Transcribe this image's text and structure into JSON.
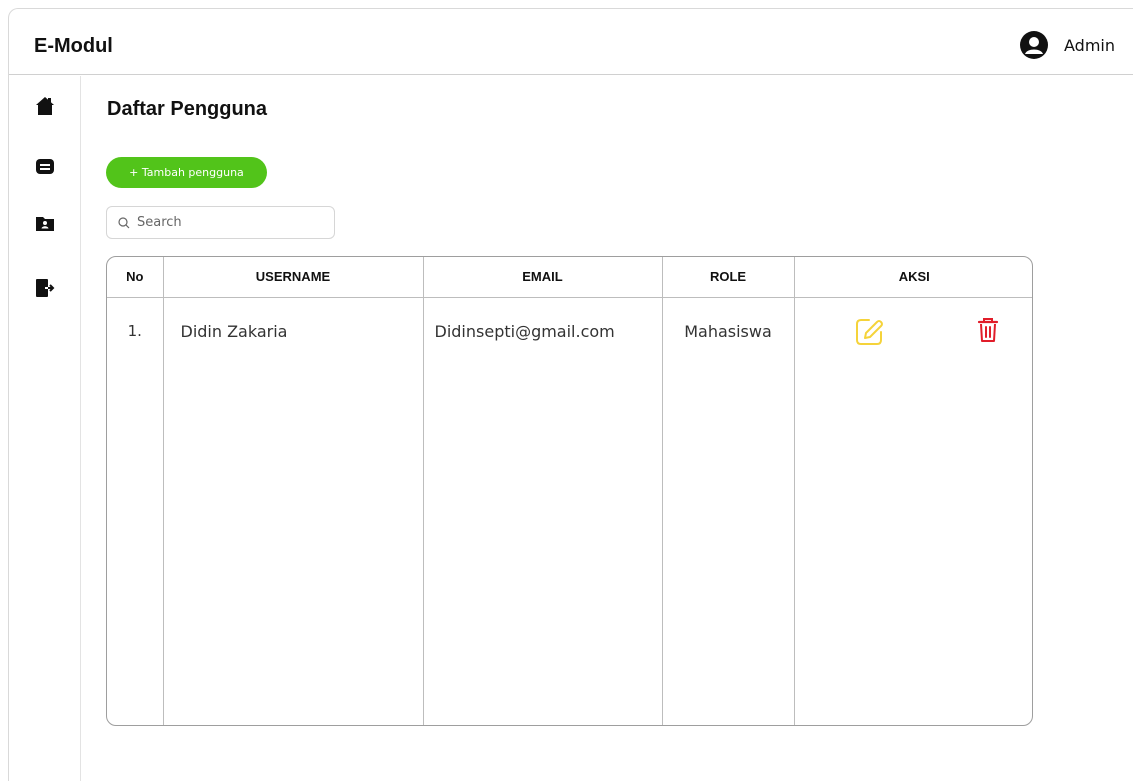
{
  "app": {
    "brand": "E-Modul"
  },
  "user": {
    "name": "Admin"
  },
  "sidebar": {
    "items": [
      {
        "icon": "home-icon"
      },
      {
        "icon": "message-icon"
      },
      {
        "icon": "folder-user-icon"
      },
      {
        "icon": "logout-icon"
      }
    ]
  },
  "page": {
    "title": "Daftar Pengguna",
    "add_button_label": "+ Tambah pengguna",
    "search_placeholder": "Search"
  },
  "table": {
    "columns": [
      "No",
      "USERNAME",
      "EMAIL",
      "ROLE",
      "AKSI"
    ],
    "rows": [
      {
        "no": "1.",
        "username": "Didin Zakaria",
        "email": "Didinsepti@gmail.com",
        "role": "Mahasiswa"
      }
    ]
  },
  "colors": {
    "accent_green": "#52c41a",
    "edit_yellow": "#f5d33a",
    "delete_red": "#e11d2a"
  }
}
